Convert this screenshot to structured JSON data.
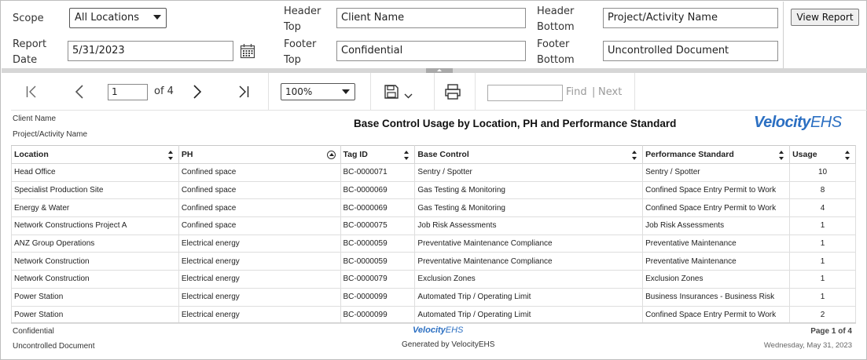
{
  "params": {
    "scope_label": "Scope",
    "scope_value": "All Locations",
    "report_date_label_1": "Report",
    "report_date_label_2": "Date",
    "report_date_value": "5/31/2023",
    "header_top_label_1": "Header",
    "header_top_label_2": "Top",
    "header_top_value": "Client Name",
    "footer_top_label_1": "Footer",
    "footer_top_label_2": "Top",
    "footer_top_value": "Confidential",
    "header_bottom_label_1": "Header",
    "header_bottom_label_2": "Bottom",
    "header_bottom_value": "Project/Activity Name",
    "footer_bottom_label_1": "Footer",
    "footer_bottom_label_2": "Bottom",
    "footer_bottom_value": "Uncontrolled Document",
    "view_report_label": "View Report"
  },
  "toolbar": {
    "current_page": "1",
    "page_of": "of 4",
    "zoom": "100%",
    "find_label": "Find",
    "find_separator": "|",
    "next_label": "Next"
  },
  "report": {
    "header_top": "Client Name",
    "header_bottom": "Project/Activity Name",
    "title": "Base Control Usage by Location, PH and Performance Standard",
    "logo_part1": "Velocity",
    "logo_part2": "EHS",
    "columns": [
      "Location",
      "PH",
      "Tag ID",
      "Base Control",
      "Performance Standard",
      "Usage"
    ],
    "rows": [
      [
        "Head Office",
        "Confined space",
        "BC-0000071",
        "Sentry / Spotter",
        "Sentry / Spotter",
        "10"
      ],
      [
        "Specialist Production Site",
        "Confined space",
        "BC-0000069",
        "Gas Testing & Monitoring",
        "Confined Space Entry Permit to Work",
        "8"
      ],
      [
        "Energy & Water",
        "Confined space",
        "BC-0000069",
        "Gas Testing & Monitoring",
        "Confined Space Entry Permit to Work",
        "4"
      ],
      [
        "Network Constructions Project A",
        "Confined space",
        "BC-0000075",
        "Job Risk Assessments",
        "Job Risk Assessments",
        "1"
      ],
      [
        "ANZ Group Operations",
        "Electrical energy",
        "BC-0000059",
        "Preventative Maintenance Compliance",
        "Preventative Maintenance",
        "1"
      ],
      [
        "Network Construction",
        "Electrical energy",
        "BC-0000059",
        "Preventative Maintenance Compliance",
        "Preventative Maintenance",
        "1"
      ],
      [
        "Network Construction",
        "Electrical energy",
        "BC-0000079",
        "Exclusion Zones",
        "Exclusion Zones",
        "1"
      ],
      [
        "Power Station",
        "Electrical energy",
        "BC-0000099",
        "Automated Trip / Operating Limit",
        "Business Insurances - Business Risk",
        "1"
      ],
      [
        "Power Station",
        "Electrical energy",
        "BC-0000099",
        "Automated Trip / Operating Limit",
        "Confined Space Entry Permit to Work",
        "2"
      ]
    ],
    "footer_top": "Confidential",
    "footer_bottom": "Uncontrolled Document",
    "generated_by": "Generated by VelocityEHS",
    "page_of": "Page 1 of 4",
    "run_date": "Wednesday, May 31, 2023"
  },
  "colors": {
    "brand": "#2b6fc2"
  },
  "icons": [
    "calendar-icon",
    "first-page-icon",
    "previous-page-icon",
    "next-page-icon",
    "last-page-icon",
    "save-icon",
    "print-icon"
  ]
}
